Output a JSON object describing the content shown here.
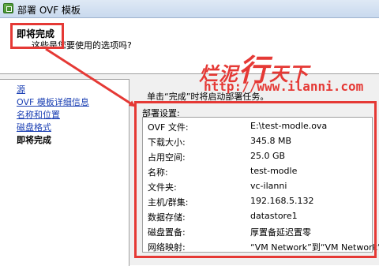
{
  "window": {
    "title": "部署 OVF 模板"
  },
  "header": {
    "title": "即将完成",
    "subtitle": "这些是您要使用的选项吗?"
  },
  "nav": {
    "items": [
      {
        "label": "源",
        "state": "link"
      },
      {
        "label": "OVF 模板详细信息",
        "state": "link"
      },
      {
        "label": "名称和位置",
        "state": "link"
      },
      {
        "label": "磁盘格式",
        "state": "link"
      },
      {
        "label": "即将完成",
        "state": "current"
      }
    ]
  },
  "main": {
    "instruction": "单击“完成”时将启动部署任务。",
    "settings_title": "部署设置:",
    "settings": [
      {
        "label": "OVF 文件:",
        "value": "E:\\test-modle.ova"
      },
      {
        "label": "下载大小:",
        "value": "345.8 MB"
      },
      {
        "label": "占用空间:",
        "value": "25.0 GB"
      },
      {
        "label": "名称:",
        "value": "test-modle"
      },
      {
        "label": "文件夹:",
        "value": "vc-ilanni"
      },
      {
        "label": "主机/群集:",
        "value": "192.168.5.132"
      },
      {
        "label": "数据存储:",
        "value": "datastore1"
      },
      {
        "label": "磁盘置备:",
        "value": "厚置备延迟置零"
      },
      {
        "label": "网络映射:",
        "value": "“VM Network”到“VM Network”"
      }
    ]
  },
  "watermark": {
    "part1": "烂泥",
    "part2": "行",
    "part3": "天下",
    "url": "http://www.ilanni.com"
  },
  "colors": {
    "annotation_red": "#e53935",
    "link_blue": "#1a3fb3",
    "panel_bg": "#f0f0f0"
  }
}
